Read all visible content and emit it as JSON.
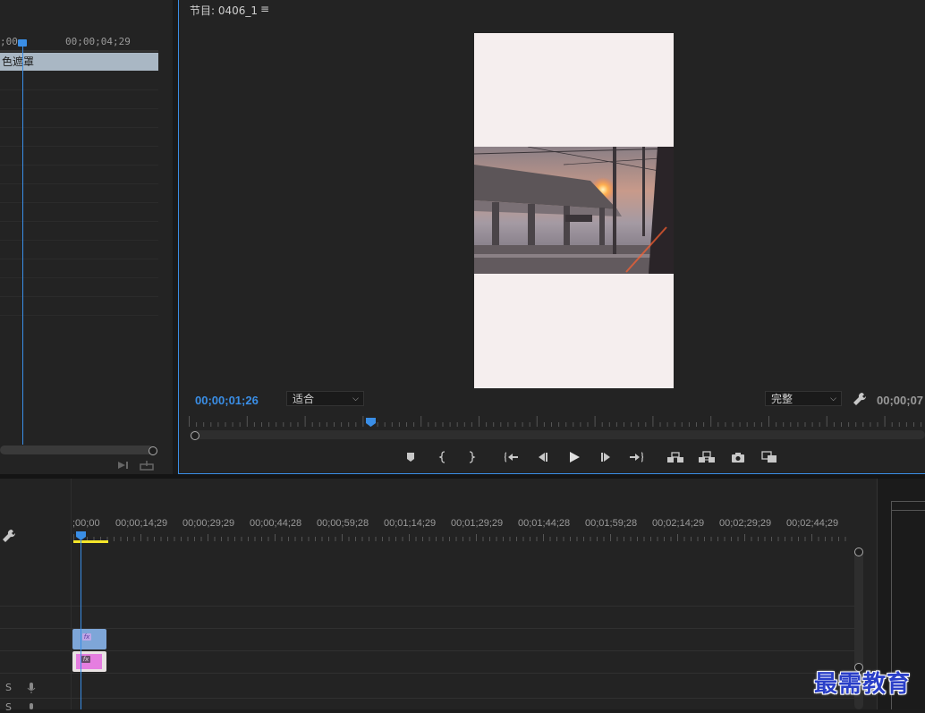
{
  "source_monitor": {
    "ruler_tc_left": ";00",
    "ruler_tc_right": "00;00;04;29",
    "clip_label": "色遮罩"
  },
  "program_monitor": {
    "title": "节目: 0406_1",
    "menu_icon": "≡",
    "current_timecode": "00;00;01;26",
    "fit_option": "适合",
    "quality_option": "完整",
    "duration_timecode": "00;00;07",
    "playhead_fraction": 0.25
  },
  "transport_controls": [
    {
      "name": "add-marker",
      "icon": "marker-icon"
    },
    {
      "name": "mark-in",
      "icon": "mark-in-icon"
    },
    {
      "name": "mark-out",
      "icon": "mark-out-icon"
    },
    {
      "name": "go-to-in",
      "icon": "go-to-in-icon"
    },
    {
      "name": "step-back",
      "icon": "step-back-icon"
    },
    {
      "name": "play",
      "icon": "play-icon"
    },
    {
      "name": "step-forward",
      "icon": "step-forward-icon"
    },
    {
      "name": "go-to-out",
      "icon": "go-to-out-icon"
    },
    {
      "name": "lift",
      "icon": "lift-icon"
    },
    {
      "name": "extract",
      "icon": "extract-icon"
    },
    {
      "name": "export-frame",
      "icon": "camera-icon"
    },
    {
      "name": "compare-view",
      "icon": "compare-icon"
    }
  ],
  "timeline": {
    "ruler_labels": [
      ";00;00",
      "00;00;14;29",
      "00;00;29;29",
      "00;00;44;28",
      "00;00;59;28",
      "00;01;14;29",
      "00;01;29;29",
      "00;01;44;28",
      "00;01;59;28",
      "00;02;14;29",
      "00;02;29;29",
      "00;02;44;29"
    ],
    "audio_track_labels": [
      "S",
      "S"
    ],
    "clips": [
      {
        "track": "V2",
        "fx": "fx",
        "color": "#7ea6d8"
      },
      {
        "track": "V1",
        "fx": "fx",
        "color": "#e57ee0"
      }
    ]
  },
  "watermark": "最需教育",
  "colors": {
    "accent": "#3a8ee6",
    "work_area": "#f5e62a",
    "panel_bg": "#232323"
  }
}
